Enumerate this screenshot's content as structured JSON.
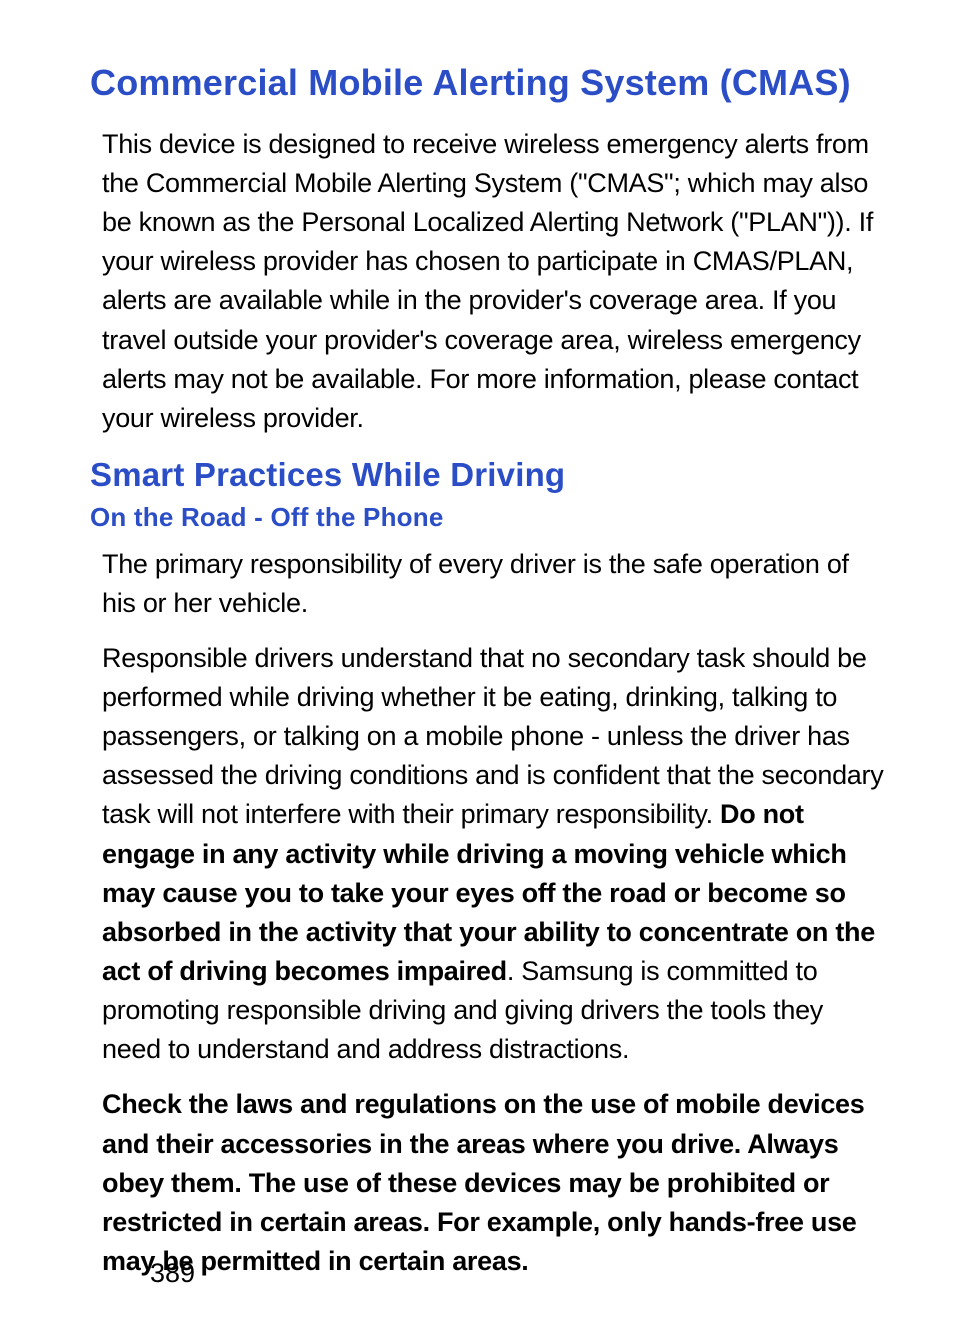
{
  "section1": {
    "title": "Commercial Mobile Alerting System (CMAS)",
    "p1": "This device is designed to receive wireless emergency alerts from the Commercial Mobile Alerting System (\"CMAS\"; which may also be known as the Personal Localized Alerting Network (\"PLAN\")). If your wireless provider has chosen to participate in CMAS/PLAN, alerts are available while in the provider's coverage area. If you travel outside your provider's coverage area, wireless emergency alerts may not be available. For more information, please contact your wireless provider."
  },
  "section2": {
    "title": "Smart Practices While Driving",
    "subtitle": "On the Road - Off the Phone",
    "p1": "The primary responsibility of every driver is the safe operation of his or her vehicle.",
    "p2a": "Responsible drivers understand that no secondary task should be performed while driving whether it be eating, drinking, talking to passengers, or talking on a mobile phone - unless the driver has assessed the driving conditions and is confident that the secondary task will not interfere with their primary responsibility. ",
    "p2b": "Do not engage in any activity while driving a moving vehicle which may cause you to take your eyes off the road or become so absorbed in the activity that your ability to concentrate on the act of driving becomes impaired",
    "p2c": ". Samsung is committed to promoting responsible driving and giving drivers the tools they need to understand and address distractions.",
    "p3": "Check the laws and regulations on the use of mobile devices and their accessories in the areas where you drive. Always obey them. The use of these devices may be prohibited or restricted in certain areas. For example, only hands-free use may be permitted in certain areas."
  },
  "page_number": "389"
}
